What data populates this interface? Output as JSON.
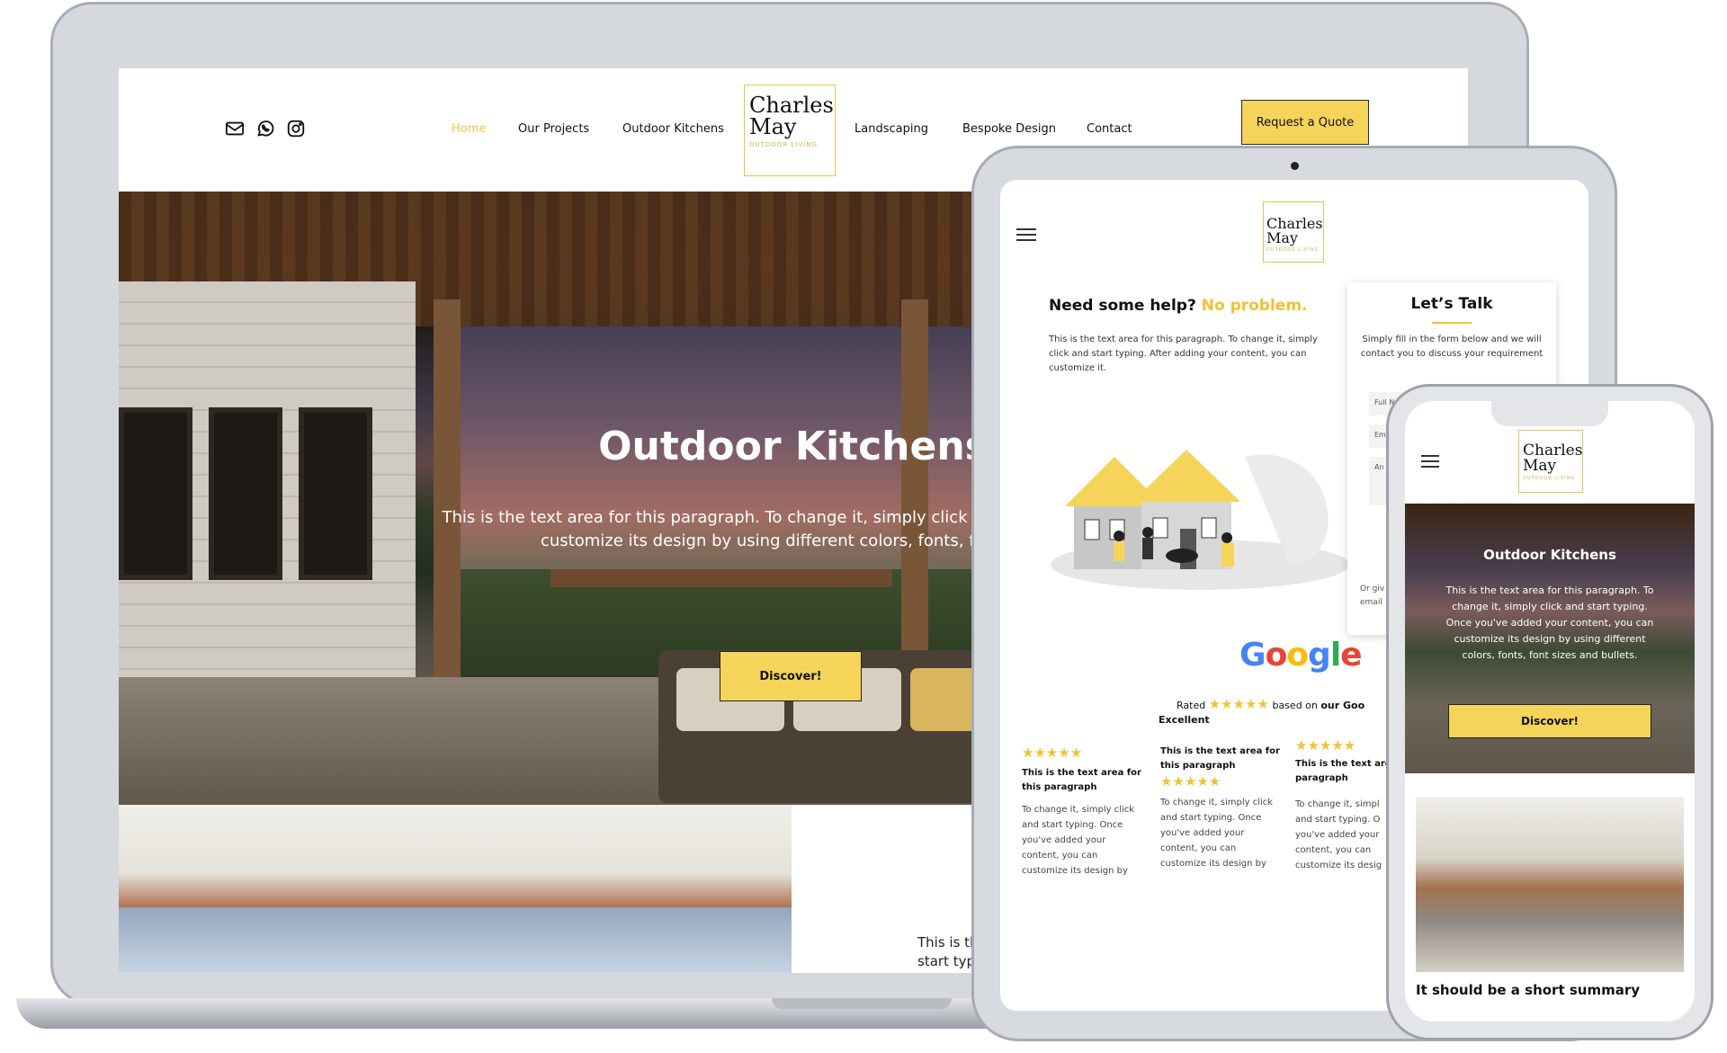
{
  "brand": {
    "logo_line1": "Charles",
    "logo_line2": "May",
    "logo_tagline": "OUTDOOR LIVING",
    "accent_color": "#f5d45a"
  },
  "laptop": {
    "header_icons": [
      "mail-icon",
      "whatsapp-icon",
      "instagram-icon"
    ],
    "nav": {
      "home": "Home",
      "our_projects": "Our Projects",
      "outdoor_kitchens": "Outdoor Kitchens",
      "landscaping": "Landscaping",
      "bespoke_design": "Bespoke Design",
      "contact": "Contact"
    },
    "quote_button": "Request a Quote",
    "hero": {
      "title": "Outdoor Kitchens",
      "text_line1": "This is the text area for this paragraph. To change it, simply click and start typing. Onc",
      "text_line2": "customize its design by using different colors, fonts, font sizes",
      "button": "Discover!"
    },
    "strip": {
      "text_line1": "This is th",
      "text_line2": "start typ"
    }
  },
  "tablet": {
    "help": {
      "heading": "Need some help?",
      "heading_highlight": "No problem.",
      "paragraph": "This is the text area for this paragraph. To change it, simply click and start typing. After adding your content, you can customize it."
    },
    "talk": {
      "title": "Let’s Talk",
      "subtitle": "Simply fill in the form below and we will contact you to discuss your requirement",
      "field_name": "Full N",
      "field_email": "Em",
      "field_message": "An",
      "footer_line1": "Or giv",
      "footer_line2": "email"
    },
    "google": {
      "logo": [
        "G",
        "o",
        "o",
        "g",
        "l",
        "e"
      ],
      "rated": "Rated",
      "stars": "★★★★★",
      "based_on": "based on",
      "our": "our Goo",
      "excellent": "Excellent"
    },
    "reviews": [
      {
        "stars": "★★★★★",
        "title": "This is the text area for this paragraph",
        "body": [
          "To change it, simply click",
          "and start typing. Once",
          "you've added your",
          "content, you  can",
          "customize its design by"
        ]
      },
      {
        "stars": "★★★★★",
        "title": "This is the text area for this paragraph",
        "body": [
          "To change it, simply click",
          "and start typing. Once",
          "you've added your",
          "content, you  can",
          "customize its design by"
        ]
      },
      {
        "stars": "★★★★★",
        "title": "This is the text area paragraph",
        "body": [
          "To change it, simpl",
          "and start typing. O",
          "you've added your",
          "content, you  can",
          "customize its desig"
        ]
      }
    ]
  },
  "phone": {
    "hero": {
      "title": "Outdoor Kitchens",
      "text": "This is the text area for this paragraph. To change it, simply click and start typing. Once you've added your content, you  can customize its design by using different colors, fonts, font sizes and bullets.",
      "button": "Discover!"
    },
    "summary": "It should be a short summary"
  }
}
